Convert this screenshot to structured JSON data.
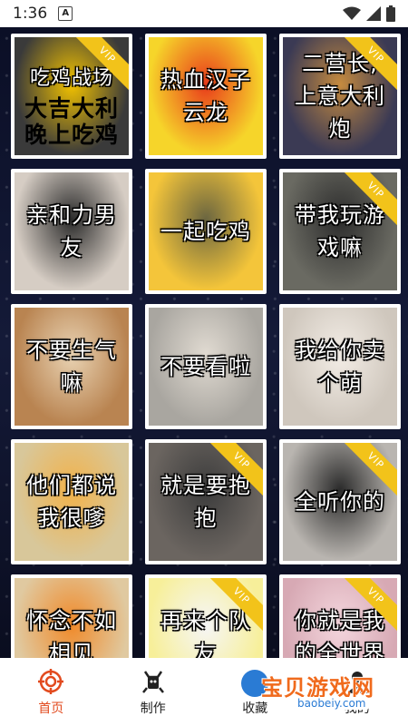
{
  "status": {
    "time": "1:36",
    "notif_icon": "A"
  },
  "cards": [
    {
      "caption": "吃鸡战场",
      "extra": "大吉大利\n晚上吃鸡",
      "vip": true,
      "bg": "#3a3a3a",
      "accent": "#f2c200"
    },
    {
      "caption": "热血汉子\n云龙",
      "vip": false,
      "bg": "#f6d52a",
      "accent": "#e93c1b"
    },
    {
      "caption": "二营长,\n上意大利\n炮",
      "vip": true,
      "bg": "#3b3a54",
      "accent": "#c68b3f"
    },
    {
      "caption": "亲和力男\n友",
      "vip": false,
      "bg": "#d6cdc4",
      "accent": "#2b2b2b"
    },
    {
      "caption": "一起吃鸡",
      "vip": false,
      "bg": "#f4c53a",
      "accent": "#6a6540"
    },
    {
      "caption": "带我玩游\n戏嘛",
      "vip": true,
      "bg": "#6a6a62",
      "accent": "#2c2c2c"
    },
    {
      "caption": "不要生气\n嘛",
      "vip": false,
      "bg": "#b98451",
      "accent": "#e9d3b3"
    },
    {
      "caption": "不要看啦",
      "vip": false,
      "bg": "#a9a6a0",
      "accent": "#e1dbd2"
    },
    {
      "caption": "我给你卖\n个萌",
      "vip": false,
      "bg": "#cfc7bd",
      "accent": "#f3ede6"
    },
    {
      "caption": "他们都说\n我很嗲",
      "vip": false,
      "bg": "#d8c79a",
      "accent": "#f2b24a"
    },
    {
      "caption": "就是要抱\n抱",
      "vip": true,
      "bg": "#6b6560",
      "accent": "#3c3c3c"
    },
    {
      "caption": "全听你的",
      "vip": true,
      "bg": "#b9b5b0",
      "accent": "#2a2a2a"
    },
    {
      "caption": "怀念不如\n相见",
      "vip": false,
      "bg": "#e0c9a0",
      "accent": "#f08a2a"
    },
    {
      "caption": "再来个队\n友",
      "vip": true,
      "bg": "#f7ef9a",
      "accent": "#f6f6f6"
    },
    {
      "caption": "你就是我\n的全世界",
      "vip": true,
      "bg": "#d7a9b4",
      "accent": "#f4d6dd"
    }
  ],
  "vip_label": "VIP",
  "tabs": [
    {
      "label": "首页",
      "icon": "home-target-icon",
      "active": true
    },
    {
      "label": "制作",
      "icon": "make-icon",
      "active": false
    },
    {
      "label": "收藏",
      "icon": "favorite-icon",
      "active": false
    },
    {
      "label": "我的",
      "icon": "profile-icon",
      "active": false
    }
  ],
  "watermark": {
    "text": "宝贝游戏网",
    "url": "baobeiy.com"
  },
  "colors": {
    "active": "#e24a1e",
    "vip": "#f2c31a"
  }
}
